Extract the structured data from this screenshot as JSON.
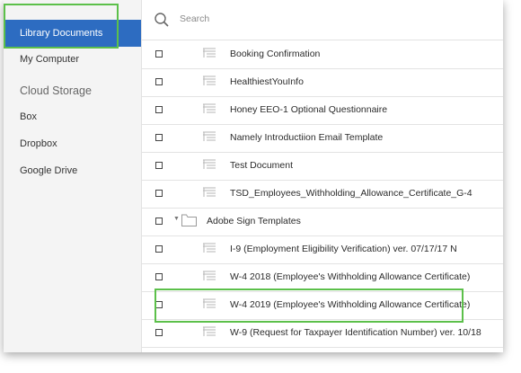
{
  "sidebar": {
    "items": [
      {
        "label": "Library Documents"
      },
      {
        "label": "My Computer"
      },
      {
        "label": "Cloud Storage"
      },
      {
        "label": "Box"
      },
      {
        "label": "Dropbox"
      },
      {
        "label": "Google Drive"
      }
    ]
  },
  "search": {
    "label": "Search"
  },
  "documents": [
    "Booking Confirmation",
    "HealthiestYouInfo",
    "Honey EEO-1 Optional Questionnaire",
    "Namely Introductiion Email Template",
    "Test Document",
    "TSD_Employees_Withholding_Allowance_Certificate_G-4"
  ],
  "folder": {
    "label": "Adobe Sign Templates",
    "items": [
      "I-9 (Employment Eligibility Verification) ver. 07/17/17 N",
      "W-4 2018 (Employee's Withholding Allowance Certificate)",
      "W-4 2019 (Employee's Withholding Allowance Certificate)",
      "W-9 (Request for Taxpayer Identification Number) ver. 10/18"
    ]
  },
  "colors": {
    "active_nav": "#2d6cc1",
    "highlight": "#5cc04a"
  }
}
